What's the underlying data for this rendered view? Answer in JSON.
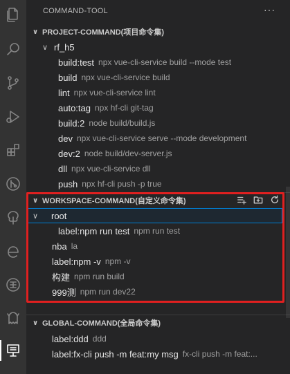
{
  "sidebar": {
    "title": "COMMAND-TOOL",
    "more": "···"
  },
  "activity_bar": {
    "icons": [
      "files-icon",
      "search-icon",
      "source-control-icon",
      "run-debug-icon",
      "extensions-icon",
      "git-graph-icon",
      "tree-icon",
      "edge-icon",
      "globe-icon",
      "mascot-icon",
      "remote-explorer-icon"
    ],
    "active": "remote-explorer-icon"
  },
  "project_section": {
    "title": "PROJECT-COMMAND(项目命令集)",
    "folder": "rf_h5",
    "items": [
      {
        "label": "build:test",
        "desc": "npx vue-cli-service build --mode test"
      },
      {
        "label": "build",
        "desc": "npx vue-cli-service build"
      },
      {
        "label": "lint",
        "desc": "npx vue-cli-service lint"
      },
      {
        "label": "auto:tag",
        "desc": "npx hf-cli git-tag"
      },
      {
        "label": "build:2",
        "desc": "node build/build.js"
      },
      {
        "label": "dev",
        "desc": "npx vue-cli-service serve  --mode development"
      },
      {
        "label": "dev:2",
        "desc": "node build/dev-server.js"
      },
      {
        "label": "dll",
        "desc": "npx vue-cli-service dll"
      },
      {
        "label": "push",
        "desc": "npx hf-cli push -p true"
      }
    ]
  },
  "workspace_section": {
    "title": "WORKSPACE-COMMAND(自定义命令集)",
    "folder": "root",
    "folder_items": [
      {
        "label": "label:npm run test",
        "desc": "npm run test"
      }
    ],
    "items": [
      {
        "label": "nba",
        "desc": "la"
      },
      {
        "label": "label:npm -v",
        "desc": "npm -v"
      },
      {
        "label": "构建",
        "desc": "npm run build"
      },
      {
        "label": "999测",
        "desc": "npm run dev22"
      }
    ],
    "actions": [
      "add-command-icon",
      "new-folder-icon",
      "refresh-icon"
    ]
  },
  "global_section": {
    "title": "GLOBAL-COMMAND(全局命令集)",
    "items": [
      {
        "label": "label:ddd",
        "desc": "ddd"
      },
      {
        "label": "label:fx-cli push -m feat:my msg",
        "desc": "fx-cli push -m feat:..."
      }
    ]
  },
  "colors": {
    "accent_blue": "#007fd4",
    "highlight_red": "#e02020",
    "sidebar_bg": "#252526",
    "activity_bg": "#333333"
  }
}
